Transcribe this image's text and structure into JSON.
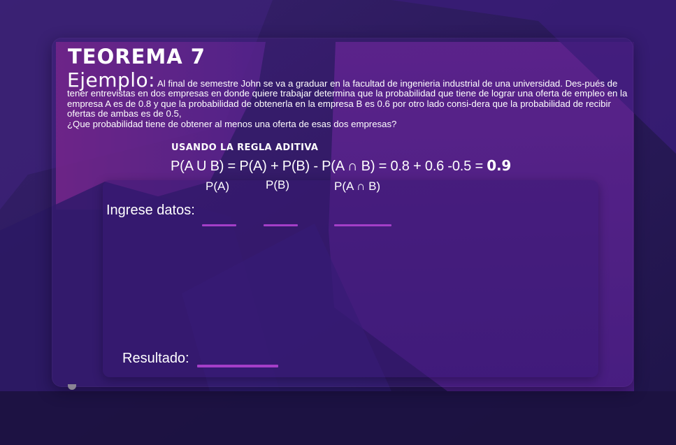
{
  "slide": {
    "title": "TEOREMA 7",
    "example_label": "Ejemplo:",
    "example_text": "Al final de semestre John se va a graduar en la facultad de ingenieria industrial de una universidad. Des-pués de tener entrevistas en dos empresas en donde quiere trabajar determina que la probabilidad que tiene de lograr una oferta de empleo en la empresa A es de 0.8 y que la probabilidad de obtenerla en la empresa B es 0.6 por otro lado  consi-dera que la probabilidad de recibir ofertas de ambas es de 0.5,",
    "question": "¿Que probabilidad tiene de obtener al menos una oferta de esas dos empresas?",
    "rule_title": "USANDO LA REGLA ADITIVA",
    "formula": "P(A U B) = P(A) + P(B) - P(A ∩ B) = 0.8 + 0.6 -0.5 = ",
    "formula_result": "0.9"
  },
  "inputs": {
    "prompt": "Ingrese datos:",
    "pa_label": "P(A)",
    "pb_label": "P(B)",
    "pab_label": "P(A ∩ B)",
    "result_label": "Resultado:"
  },
  "colors": {
    "background": "#2a1660",
    "accent_magenta": "#7a2a8e",
    "blank_line": "#a43ec8",
    "text": "#ffffff"
  }
}
